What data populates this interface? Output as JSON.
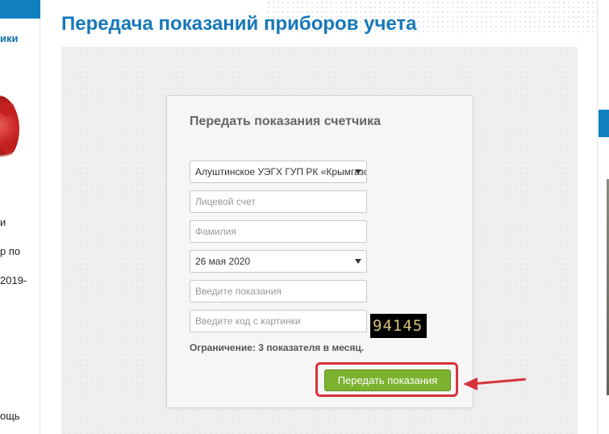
{
  "left_sidebar": {
    "heading_fragment": "ики",
    "items": [
      "и",
      "р по",
      "2019-",
      "ощь"
    ]
  },
  "page_title": "Передача показаний приборов учета",
  "form": {
    "title": "Передать показания счетчика",
    "organization_select": {
      "selected": "Алуштинское УЭГХ ГУП РК «Крымгазсети»"
    },
    "account_field": {
      "placeholder": "Лицевой счет",
      "value": ""
    },
    "surname_field": {
      "placeholder": "Фамилия",
      "value": ""
    },
    "date_select": {
      "selected": "26 мая 2020"
    },
    "reading_field": {
      "placeholder": "Введите показания",
      "value": ""
    },
    "captcha_field": {
      "placeholder": "Введите код с картинки",
      "value": ""
    },
    "captcha_code": "94145",
    "limit_note": "Ограничение: 3 показателя в месяц.",
    "submit_label": "Передать показания"
  },
  "colors": {
    "title_blue": "#1778b8",
    "submit_green": "#7cb22e",
    "annotation_red": "#d6343a"
  }
}
